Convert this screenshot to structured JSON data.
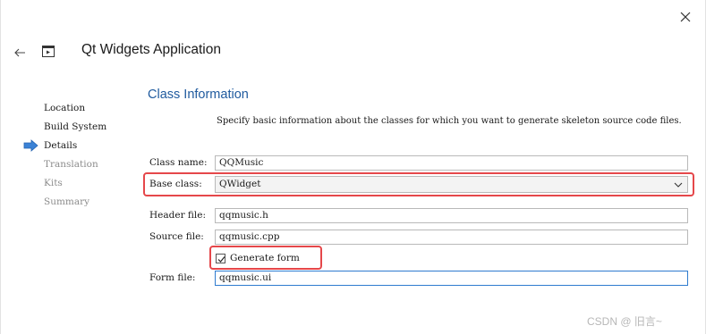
{
  "window": {
    "close_icon": "close-icon",
    "back_icon": "back-arrow-icon",
    "app_icon": "qt-application-icon"
  },
  "wizard": {
    "title": "Qt Widgets Application"
  },
  "steps": [
    {
      "label": "Location",
      "state": "done"
    },
    {
      "label": "Build System",
      "state": "done"
    },
    {
      "label": "Details",
      "state": "current"
    },
    {
      "label": "Translation",
      "state": "pending"
    },
    {
      "label": "Kits",
      "state": "pending"
    },
    {
      "label": "Summary",
      "state": "pending"
    }
  ],
  "section": {
    "title": "Class Information",
    "description": "Specify basic information about the classes for which you want to generate skeleton source code files."
  },
  "form": {
    "class_name": {
      "label": "Class name:",
      "value": "QQMusic"
    },
    "base_class": {
      "label": "Base class:",
      "value": "QWidget"
    },
    "header_file": {
      "label": "Header file:",
      "value": "qqmusic.h"
    },
    "source_file": {
      "label": "Source file:",
      "value": "qqmusic.cpp"
    },
    "generate_form": {
      "label": "Generate form",
      "checked": true
    },
    "form_file": {
      "label": "Form file:",
      "value": "qqmusic.ui"
    }
  },
  "watermark": "CSDN @ 旧言~",
  "colors": {
    "accent": "#1f5a9e",
    "focus_border": "#2e7bcf",
    "highlight_red": "#e5474a",
    "current_step_arrow": "#3b82d6"
  }
}
